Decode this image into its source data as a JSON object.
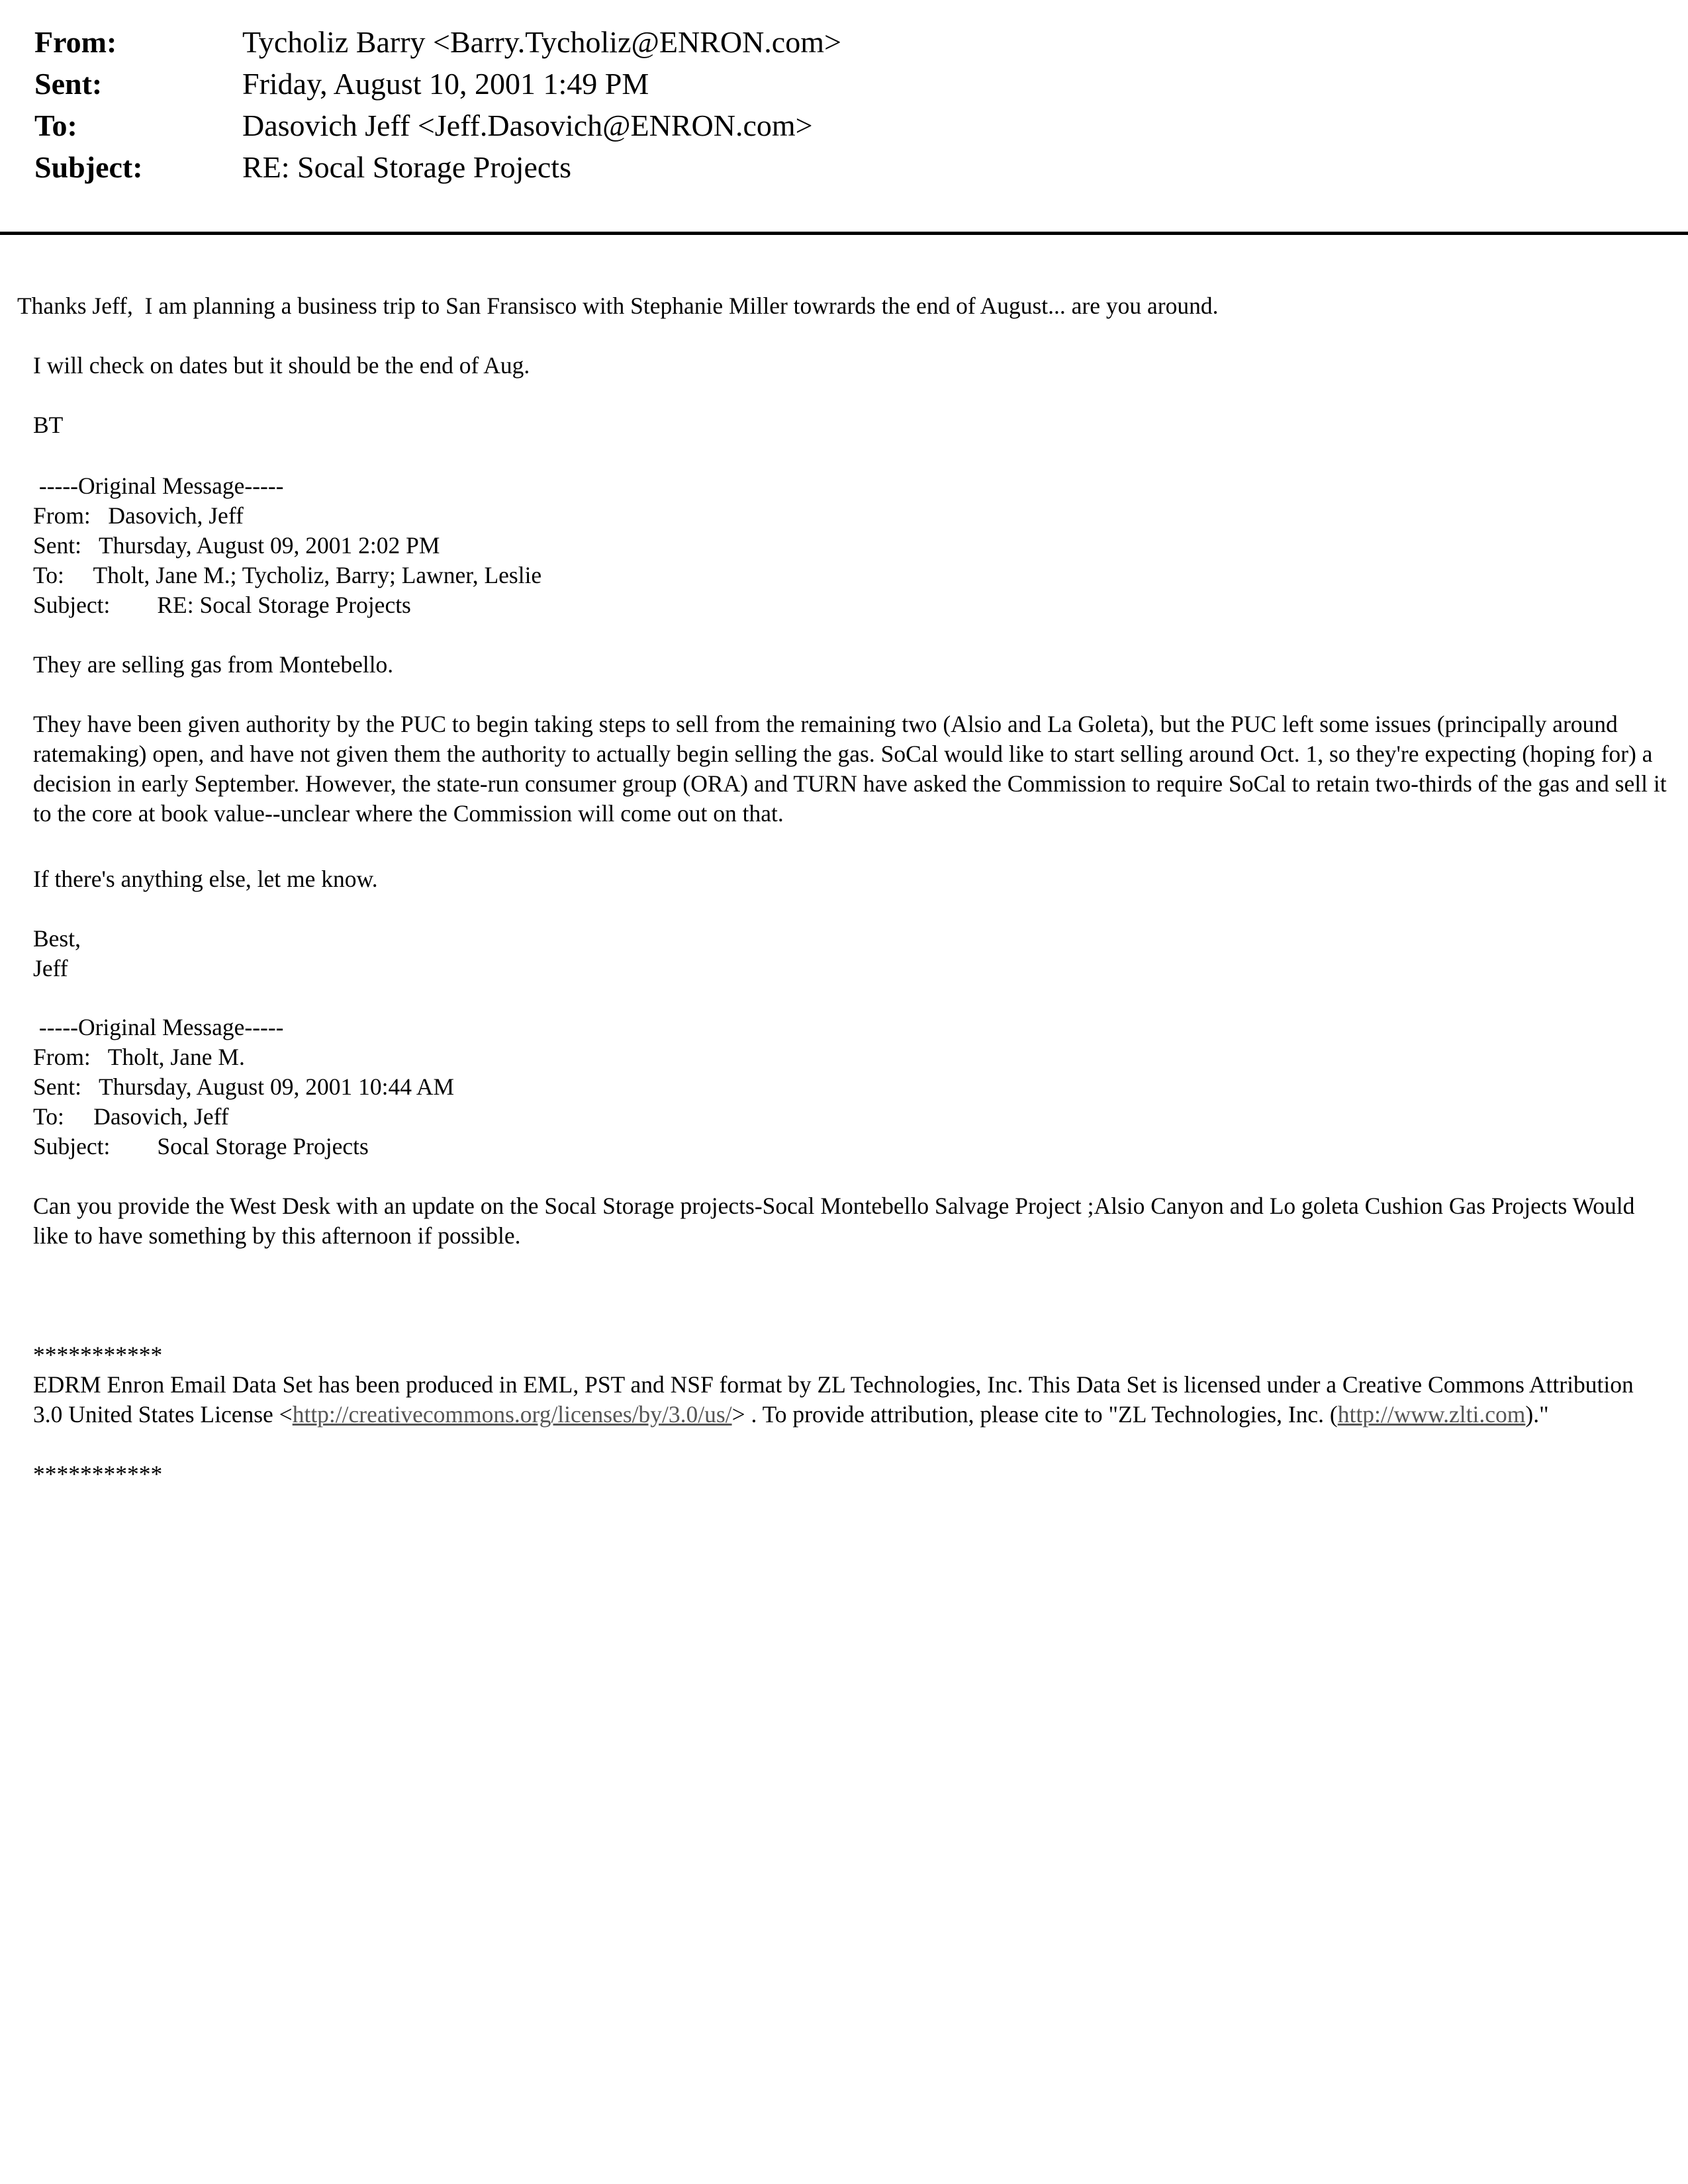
{
  "header": {
    "from_label": "From:",
    "from_value": "Tycholiz Barry <Barry.Tycholiz@ENRON.com>",
    "sent_label": "Sent:",
    "sent_value": "Friday, August 10, 2001 1:49 PM",
    "to_label": "To:",
    "to_value": "Dasovich Jeff <Jeff.Dasovich@ENRON.com>",
    "subject_label": "Subject:",
    "subject_value": "RE: Socal Storage Projects"
  },
  "reply": {
    "line1": "Thanks Jeff,  I am planning a business trip to San Fransisco with Stephanie Miller towrards the end of August... are you around.",
    "line2": "I will check on dates but it should be the end of Aug.",
    "signoff": "BT"
  },
  "original1": {
    "marker": " -----Original Message-----",
    "from": "From:   Dasovich, Jeff",
    "sent": "Sent:   Thursday, August 09, 2001 2:02 PM",
    "to": "To:     Tholt, Jane M.; Tycholiz, Barry; Lawner, Leslie",
    "subject": "Subject:        RE: Socal Storage Projects",
    "p1": "They are selling gas from Montebello.",
    "p2": "They have been given authority by the PUC to begin taking steps to sell from the remaining two (Alsio and La Goleta), but the PUC left some issues (principally around ratemaking) open, and have not given them the authority to actually begin selling the gas.  SoCal would like to start selling around Oct. 1, so they're expecting (hoping for) a decision in early September.  However, the state-run consumer group (ORA) and TURN have asked the Commission to require SoCal to retain two-thirds of the gas and sell it to the core at book value--unclear where the Commission will come out on that.",
    "p3": "If there's anything else, let me know.",
    "closing": "Best,",
    "name": "Jeff"
  },
  "original2": {
    "marker": " -----Original Message-----",
    "from": "From:   Tholt, Jane M.",
    "sent": "Sent:   Thursday, August 09, 2001 10:44 AM",
    "to": "To:     Dasovich, Jeff",
    "subject": "Subject:        Socal Storage Projects",
    "p1": "Can you provide the West Desk with an update on the Socal Storage projects-Socal Montebello Salvage Project ;Alsio Canyon and Lo goleta Cushion Gas Projects  Would like to  have something by this afternoon if possible."
  },
  "footer": {
    "stars_top": "***********",
    "text_a": "EDRM Enron Email Data Set has been produced in EML, PST and NSF format by ZL Technologies, Inc. This Data Set is licensed under a Creative Commons Attribution 3.0 United States License <",
    "link1": "http://creativecommons.org/licenses/by/3.0/us/",
    "text_b": "> . To provide attribution, please cite to \"ZL Technologies, Inc. (",
    "link2": "http://www.zlti.com",
    "text_c": ").\"",
    "stars_bottom": "***********"
  }
}
